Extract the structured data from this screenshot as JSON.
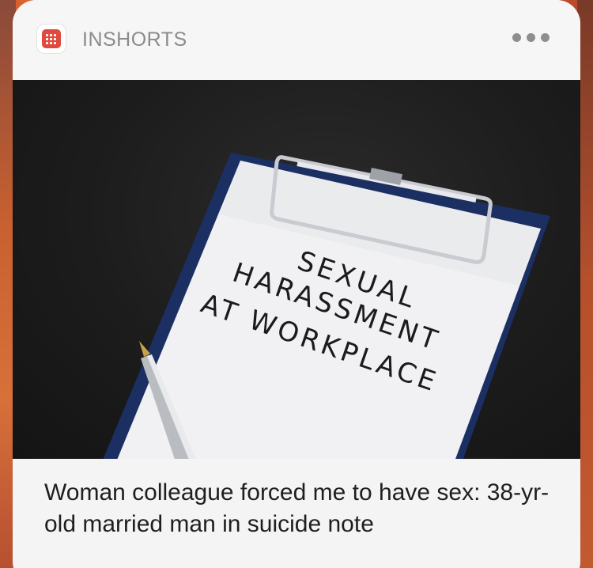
{
  "widget": {
    "app_name": "INSHORTS",
    "app_icon": "inshorts-logo-icon",
    "more_icon": "more-horizontal-icon",
    "accent_color": "#e2483d"
  },
  "article": {
    "image": {
      "clipboard_text": [
        "SEXUAL",
        "HARASSMENT",
        "AT WORKPLACE"
      ]
    },
    "title": "Woman colleague forced me to have sex: 38-yr-old married man in suicide note"
  }
}
